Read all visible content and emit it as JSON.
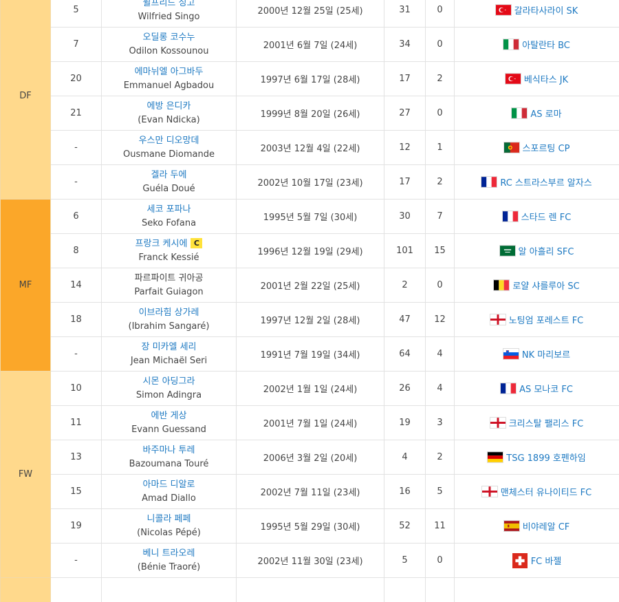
{
  "positions": {
    "df": "DF",
    "mf": "MF",
    "fw": "FW"
  },
  "captain_badge": "C",
  "players": [
    {
      "number": "5",
      "name_ko": "윌프리드 싱고",
      "name_en": "Wilfried Singo",
      "birth": "2000년 12월 25일 (25세)",
      "caps": "31",
      "goals": "0",
      "flag": "turkey-flag",
      "club": "갈라타사라이 SK"
    },
    {
      "number": "7",
      "name_ko": "오딜롱 코수누",
      "name_en": "Odilon Kossounou",
      "birth": "2001년 6월 7일 (24세)",
      "caps": "34",
      "goals": "0",
      "flag": "italy-flag",
      "club": "아탈란타 BC"
    },
    {
      "number": "20",
      "name_ko": "에마뉘엘 아그바두",
      "name_en": "Emmanuel Agbadou",
      "birth": "1997년 6월 17일 (28세)",
      "caps": "17",
      "goals": "2",
      "flag": "turkey-flag",
      "club": "베식타스 JK"
    },
    {
      "number": "21",
      "name_ko": "에방 은디카",
      "name_en": "(Evan Ndicka)",
      "birth": "1999년 8월 20일 (26세)",
      "caps": "27",
      "goals": "0",
      "flag": "italy-flag",
      "club": "AS 로마"
    },
    {
      "number": "-",
      "name_ko": "우스만 디오망데",
      "name_en": "Ousmane Diomande",
      "birth": "2003년 12월 4일 (22세)",
      "caps": "12",
      "goals": "1",
      "flag": "portugal-flag",
      "club": "스포르팅 CP"
    },
    {
      "number": "-",
      "name_ko": "겔라 두에",
      "name_en": "Guéla Doué",
      "birth": "2002년 10월 17일 (23세)",
      "caps": "17",
      "goals": "2",
      "flag": "france-flag",
      "club": "RC 스트라스부르 알자스"
    },
    {
      "number": "6",
      "name_ko": "세코 포파나",
      "name_en": "Seko Fofana",
      "birth": "1995년 5월 7일 (30세)",
      "caps": "30",
      "goals": "7",
      "flag": "france-flag",
      "club": "스타드 렌 FC"
    },
    {
      "number": "8",
      "name_ko": "프랑크 케시에",
      "name_en": "Franck Kessié",
      "birth": "1996년 12월 19일 (29세)",
      "caps": "101",
      "goals": "15",
      "flag": "saudi-arabia-flag",
      "club": "알 아흘리 SFC",
      "captain": true
    },
    {
      "number": "14",
      "name_ko": "파르파이트 귀아공",
      "name_en": "Parfait Guiagon",
      "birth": "2001년 2월 22일 (25세)",
      "caps": "2",
      "goals": "0",
      "flag": "belgium-flag",
      "club": "로얄 샤를루아 SC",
      "plain": true
    },
    {
      "number": "18",
      "name_ko": "이브라힘 상가레",
      "name_en": "(Ibrahim Sangaré)",
      "birth": "1997년 12월 2일 (28세)",
      "caps": "47",
      "goals": "12",
      "flag": "england-flag",
      "club": "노팅엄 포레스트 FC"
    },
    {
      "number": "-",
      "name_ko": "장 미카엘 세리",
      "name_en": "Jean Michaël Seri",
      "birth": "1991년 7월 19일 (34세)",
      "caps": "64",
      "goals": "4",
      "flag": "slovenia-flag",
      "club": "NK 마리보르"
    },
    {
      "number": "10",
      "name_ko": "시몬 아딩그라",
      "name_en": "Simon Adingra",
      "birth": "2002년 1월 1일 (24세)",
      "caps": "26",
      "goals": "4",
      "flag": "france-flag",
      "club": "AS 모나코 FC"
    },
    {
      "number": "11",
      "name_ko": "에반 게상",
      "name_en": "Evann Guessand",
      "birth": "2001년 7월 1일 (24세)",
      "caps": "19",
      "goals": "3",
      "flag": "england-flag",
      "club": "크리스탈 팰리스 FC"
    },
    {
      "number": "13",
      "name_ko": "바주마나 투레",
      "name_en": "Bazoumana Touré",
      "birth": "2006년 3월 2일 (20세)",
      "caps": "4",
      "goals": "2",
      "flag": "germany-flag",
      "club": "TSG 1899 호펜하임"
    },
    {
      "number": "15",
      "name_ko": "아마드 디알로",
      "name_en": "Amad Diallo",
      "birth": "2002년 7월 11일 (23세)",
      "caps": "16",
      "goals": "5",
      "flag": "england-flag",
      "club": "맨체스터 유나이티드 FC"
    },
    {
      "number": "19",
      "name_ko": "니콜라 페페",
      "name_en": "(Nicolas Pépé)",
      "birth": "1995년 5월 29일 (30세)",
      "caps": "52",
      "goals": "11",
      "flag": "spain-flag",
      "club": "비야레알 CF"
    },
    {
      "number": "-",
      "name_ko": "베니 트라오레",
      "name_en": "(Bénie Traoré)",
      "birth": "2002년 11월 30일 (23세)",
      "caps": "5",
      "goals": "0",
      "flag": "switzerland-flag",
      "club": "FC 바젤"
    }
  ]
}
